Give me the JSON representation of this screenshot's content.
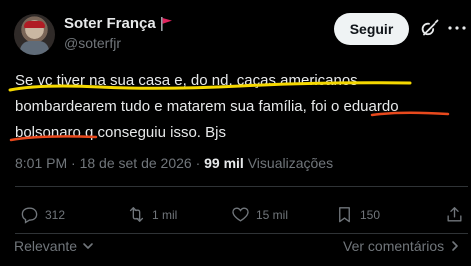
{
  "author": {
    "name": "Soter França",
    "handle": "@soterfjr",
    "flag_icon": "red-flag-icon"
  },
  "header": {
    "follow_label": "Seguir"
  },
  "tweet": {
    "lines": [
      "Se vc tiver na sua casa e, do nd, caças americanos",
      "bombardearem tudo e matarem sua família, foi o eduardo",
      "bolsonaro q conseguiu isso. Bjs"
    ]
  },
  "meta": {
    "time_date": "8:01 PM · 18 de set de 2026 · ",
    "views_count": "99 mil",
    "views_label": " Visualizações"
  },
  "actions": {
    "replies": "312",
    "reposts": "1 mil",
    "likes": "15 mil",
    "bookmarks": "150"
  },
  "footer": {
    "sort_label": "Relevante",
    "see_replies_label": "Ver comentários"
  },
  "colors": {
    "background": "#000000",
    "text": "#e7e9ea",
    "muted": "#71767b",
    "highlight_yellow": "#f5d800",
    "highlight_red": "#e8491d",
    "flag": "#e0245e"
  }
}
